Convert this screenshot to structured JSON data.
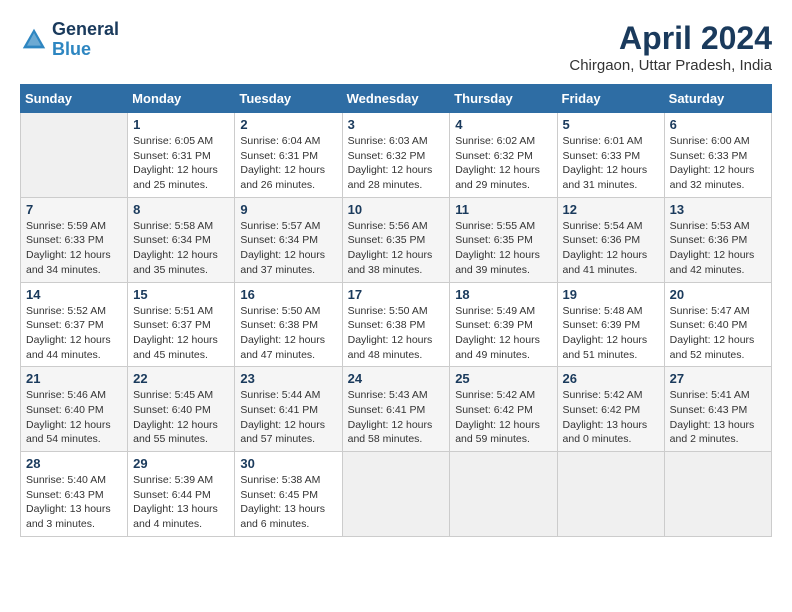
{
  "header": {
    "logo_line1": "General",
    "logo_line2": "Blue",
    "title": "April 2024",
    "subtitle": "Chirgaon, Uttar Pradesh, India"
  },
  "calendar": {
    "days_of_week": [
      "Sunday",
      "Monday",
      "Tuesday",
      "Wednesday",
      "Thursday",
      "Friday",
      "Saturday"
    ],
    "weeks": [
      [
        {
          "num": "",
          "info": ""
        },
        {
          "num": "1",
          "info": "Sunrise: 6:05 AM\nSunset: 6:31 PM\nDaylight: 12 hours\nand 25 minutes."
        },
        {
          "num": "2",
          "info": "Sunrise: 6:04 AM\nSunset: 6:31 PM\nDaylight: 12 hours\nand 26 minutes."
        },
        {
          "num": "3",
          "info": "Sunrise: 6:03 AM\nSunset: 6:32 PM\nDaylight: 12 hours\nand 28 minutes."
        },
        {
          "num": "4",
          "info": "Sunrise: 6:02 AM\nSunset: 6:32 PM\nDaylight: 12 hours\nand 29 minutes."
        },
        {
          "num": "5",
          "info": "Sunrise: 6:01 AM\nSunset: 6:33 PM\nDaylight: 12 hours\nand 31 minutes."
        },
        {
          "num": "6",
          "info": "Sunrise: 6:00 AM\nSunset: 6:33 PM\nDaylight: 12 hours\nand 32 minutes."
        }
      ],
      [
        {
          "num": "7",
          "info": "Sunrise: 5:59 AM\nSunset: 6:33 PM\nDaylight: 12 hours\nand 34 minutes."
        },
        {
          "num": "8",
          "info": "Sunrise: 5:58 AM\nSunset: 6:34 PM\nDaylight: 12 hours\nand 35 minutes."
        },
        {
          "num": "9",
          "info": "Sunrise: 5:57 AM\nSunset: 6:34 PM\nDaylight: 12 hours\nand 37 minutes."
        },
        {
          "num": "10",
          "info": "Sunrise: 5:56 AM\nSunset: 6:35 PM\nDaylight: 12 hours\nand 38 minutes."
        },
        {
          "num": "11",
          "info": "Sunrise: 5:55 AM\nSunset: 6:35 PM\nDaylight: 12 hours\nand 39 minutes."
        },
        {
          "num": "12",
          "info": "Sunrise: 5:54 AM\nSunset: 6:36 PM\nDaylight: 12 hours\nand 41 minutes."
        },
        {
          "num": "13",
          "info": "Sunrise: 5:53 AM\nSunset: 6:36 PM\nDaylight: 12 hours\nand 42 minutes."
        }
      ],
      [
        {
          "num": "14",
          "info": "Sunrise: 5:52 AM\nSunset: 6:37 PM\nDaylight: 12 hours\nand 44 minutes."
        },
        {
          "num": "15",
          "info": "Sunrise: 5:51 AM\nSunset: 6:37 PM\nDaylight: 12 hours\nand 45 minutes."
        },
        {
          "num": "16",
          "info": "Sunrise: 5:50 AM\nSunset: 6:38 PM\nDaylight: 12 hours\nand 47 minutes."
        },
        {
          "num": "17",
          "info": "Sunrise: 5:50 AM\nSunset: 6:38 PM\nDaylight: 12 hours\nand 48 minutes."
        },
        {
          "num": "18",
          "info": "Sunrise: 5:49 AM\nSunset: 6:39 PM\nDaylight: 12 hours\nand 49 minutes."
        },
        {
          "num": "19",
          "info": "Sunrise: 5:48 AM\nSunset: 6:39 PM\nDaylight: 12 hours\nand 51 minutes."
        },
        {
          "num": "20",
          "info": "Sunrise: 5:47 AM\nSunset: 6:40 PM\nDaylight: 12 hours\nand 52 minutes."
        }
      ],
      [
        {
          "num": "21",
          "info": "Sunrise: 5:46 AM\nSunset: 6:40 PM\nDaylight: 12 hours\nand 54 minutes."
        },
        {
          "num": "22",
          "info": "Sunrise: 5:45 AM\nSunset: 6:40 PM\nDaylight: 12 hours\nand 55 minutes."
        },
        {
          "num": "23",
          "info": "Sunrise: 5:44 AM\nSunset: 6:41 PM\nDaylight: 12 hours\nand 57 minutes."
        },
        {
          "num": "24",
          "info": "Sunrise: 5:43 AM\nSunset: 6:41 PM\nDaylight: 12 hours\nand 58 minutes."
        },
        {
          "num": "25",
          "info": "Sunrise: 5:42 AM\nSunset: 6:42 PM\nDaylight: 12 hours\nand 59 minutes."
        },
        {
          "num": "26",
          "info": "Sunrise: 5:42 AM\nSunset: 6:42 PM\nDaylight: 13 hours\nand 0 minutes."
        },
        {
          "num": "27",
          "info": "Sunrise: 5:41 AM\nSunset: 6:43 PM\nDaylight: 13 hours\nand 2 minutes."
        }
      ],
      [
        {
          "num": "28",
          "info": "Sunrise: 5:40 AM\nSunset: 6:43 PM\nDaylight: 13 hours\nand 3 minutes."
        },
        {
          "num": "29",
          "info": "Sunrise: 5:39 AM\nSunset: 6:44 PM\nDaylight: 13 hours\nand 4 minutes."
        },
        {
          "num": "30",
          "info": "Sunrise: 5:38 AM\nSunset: 6:45 PM\nDaylight: 13 hours\nand 6 minutes."
        },
        {
          "num": "",
          "info": ""
        },
        {
          "num": "",
          "info": ""
        },
        {
          "num": "",
          "info": ""
        },
        {
          "num": "",
          "info": ""
        }
      ]
    ]
  }
}
